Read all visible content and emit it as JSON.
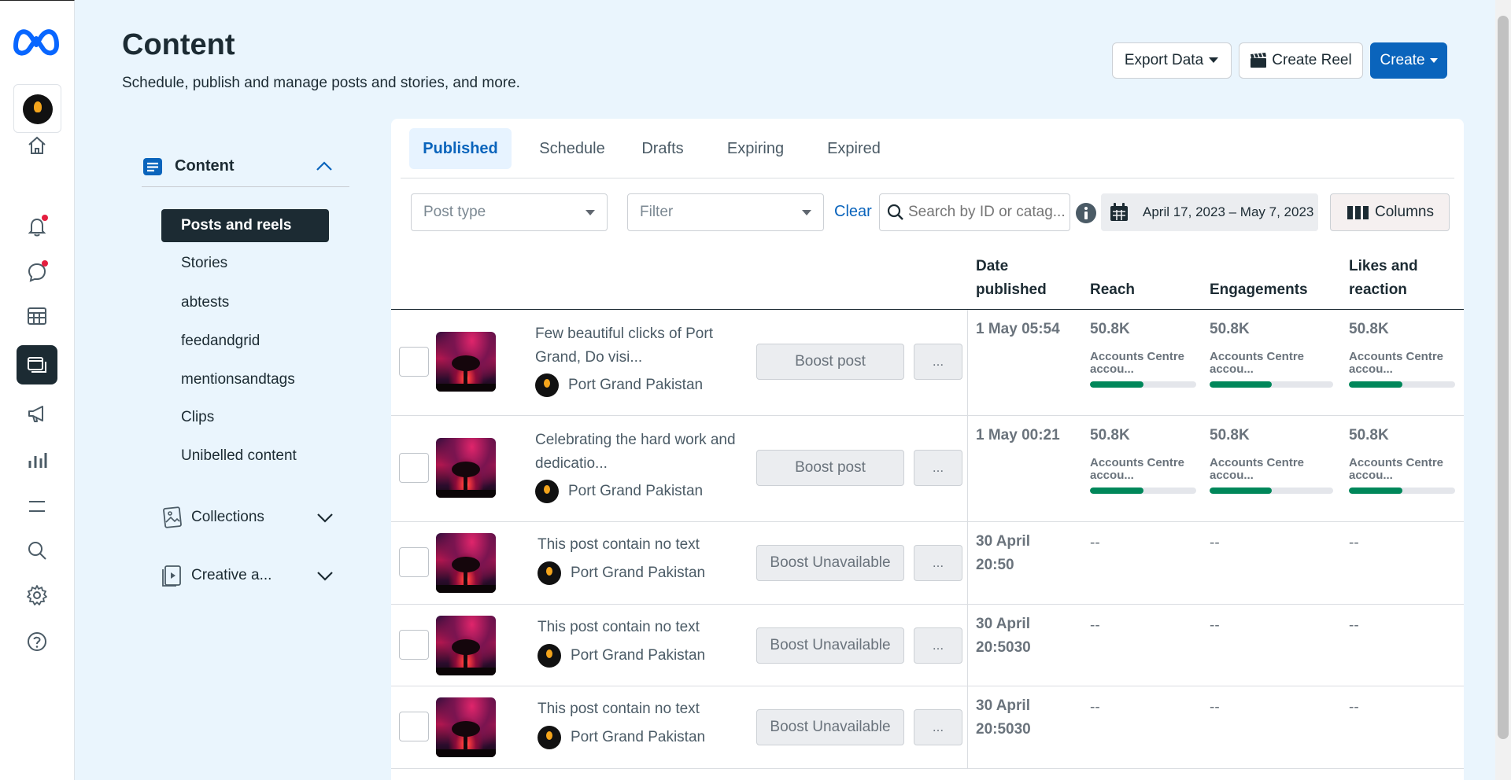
{
  "header": {
    "title": "Content",
    "subtitle": "Schedule, publish and manage posts and stories, and more.",
    "export_label": "Export Data",
    "create_reel_label": "Create Reel",
    "create_label": "Create"
  },
  "secondary_nav": {
    "section_label": "Content",
    "items": [
      {
        "label": "Posts and reels"
      },
      {
        "label": "Stories"
      },
      {
        "label": "abtests"
      },
      {
        "label": "feedandgrid"
      },
      {
        "label": "mentionsandtags"
      },
      {
        "label": "Clips"
      },
      {
        "label": "Unibelled content"
      }
    ],
    "collections_label": "Collections",
    "creative_label": "Creative a..."
  },
  "tabs": [
    {
      "label": "Published"
    },
    {
      "label": "Schedule"
    },
    {
      "label": "Drafts"
    },
    {
      "label": "Expiring"
    },
    {
      "label": "Expired"
    }
  ],
  "filters": {
    "post_type_placeholder": "Post type",
    "filter_placeholder": "Filter",
    "clear_label": "Clear",
    "search_placeholder": "Search by ID or catag...",
    "date_range": "April 17, 2023 – May 7, 2023",
    "columns_label": "Columns"
  },
  "columns": {
    "date": "Date published",
    "reach": "Reach",
    "engagements": "Engagements",
    "likes": "Likes and reaction"
  },
  "rows": [
    {
      "title": "Few beautiful clicks of Port Grand, Do visi...",
      "author": "Port Grand Pakistan",
      "boost": "Boost post",
      "more": "...",
      "date": "1 May 05:54",
      "reach": {
        "value": "50.8K",
        "sub": "Accounts Centre accou...",
        "progress": 0.5
      },
      "engagements": {
        "value": "50.8K",
        "sub": "Accounts Centre accou...",
        "progress": 0.5
      },
      "likes": {
        "value": "50.8K",
        "sub": "Accounts Centre accou...",
        "progress": 0.5
      }
    },
    {
      "title": "Celebrating the hard work and dedicatio...",
      "author": "Port Grand Pakistan",
      "boost": "Boost post",
      "more": "...",
      "date": "1 May 00:21",
      "reach": {
        "value": "50.8K",
        "sub": "Accounts Centre accou...",
        "progress": 0.5
      },
      "engagements": {
        "value": "50.8K",
        "sub": "Accounts Centre accou...",
        "progress": 0.5
      },
      "likes": {
        "value": "50.8K",
        "sub": "Accounts Centre accou...",
        "progress": 0.5
      }
    },
    {
      "title": "This post contain no text",
      "author": "Port Grand Pakistan",
      "boost": "Boost Unavailable",
      "more": "...",
      "date": "30 April 20:50",
      "reach": "--",
      "engagements": "--",
      "likes": "--"
    },
    {
      "title": "This post contain no text",
      "author": "Port Grand Pakistan",
      "boost": "Boost Unavailable",
      "more": "...",
      "date": "30 April 20:5030",
      "reach": "--",
      "engagements": "--",
      "likes": "--"
    },
    {
      "title": "This post contain no text",
      "author": "Port Grand Pakistan",
      "boost": "Boost Unavailable",
      "more": "...",
      "date": "30 April 20:5030",
      "reach": "--",
      "engagements": "--",
      "likes": "--"
    }
  ],
  "colors": {
    "primary": "#0a64bc",
    "dark_nav": "#1c2b33",
    "progress_fill": "#00875a",
    "background": "#eaf5fd",
    "notification_dot": "#e41e3f"
  },
  "icons": {
    "rail": [
      "meta-logo-icon",
      "home-icon",
      "bell-icon",
      "chat-icon",
      "grid-icon",
      "content-icon",
      "megaphone-icon",
      "insights-icon",
      "menu-icon",
      "search-icon",
      "settings-icon",
      "help-icon"
    ]
  }
}
